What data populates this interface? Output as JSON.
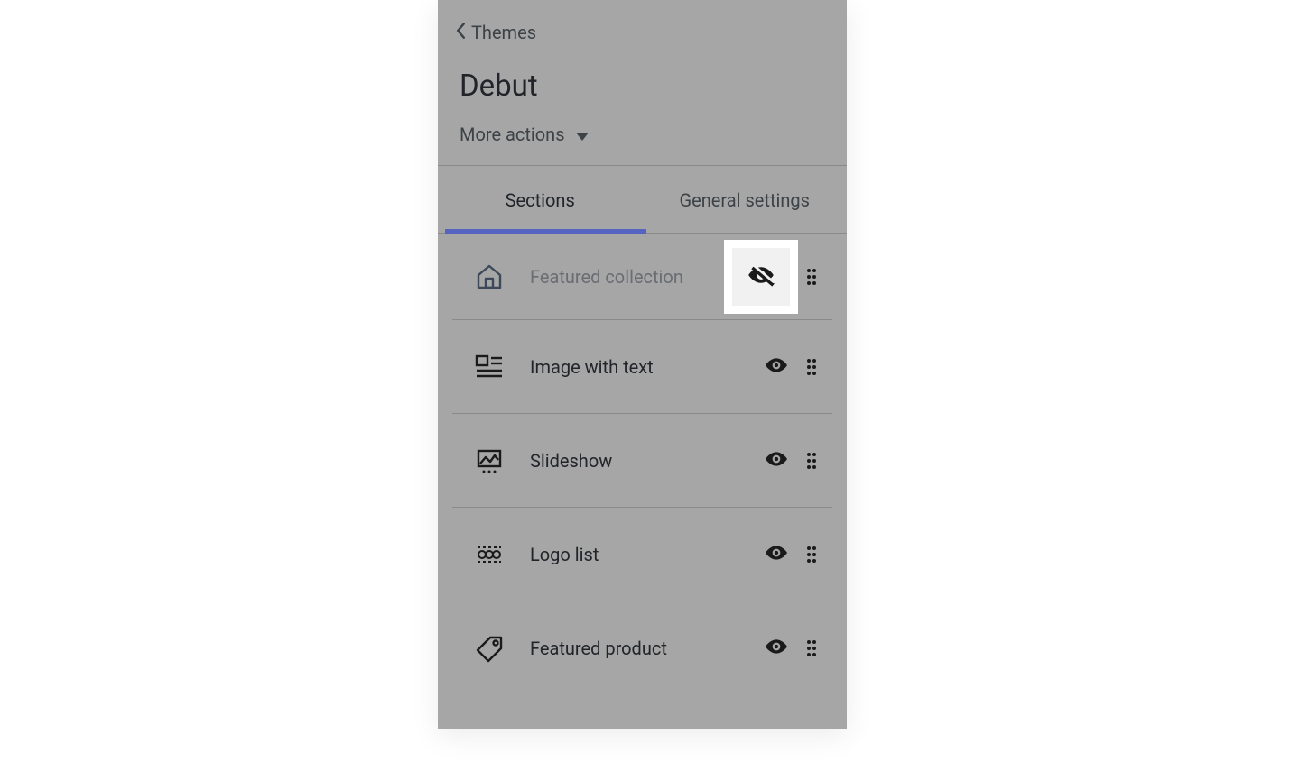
{
  "header": {
    "back_label": "Themes",
    "title": "Debut",
    "more_actions_label": "More actions"
  },
  "tabs": {
    "sections": "Sections",
    "general": "General settings"
  },
  "sections": [
    {
      "label": "Featured collection",
      "visible": false,
      "highlighted": true
    },
    {
      "label": "Image with text",
      "visible": true,
      "highlighted": false
    },
    {
      "label": "Slideshow",
      "visible": true,
      "highlighted": false
    },
    {
      "label": "Logo list",
      "visible": true,
      "highlighted": false
    },
    {
      "label": "Featured product",
      "visible": true,
      "highlighted": false
    }
  ]
}
